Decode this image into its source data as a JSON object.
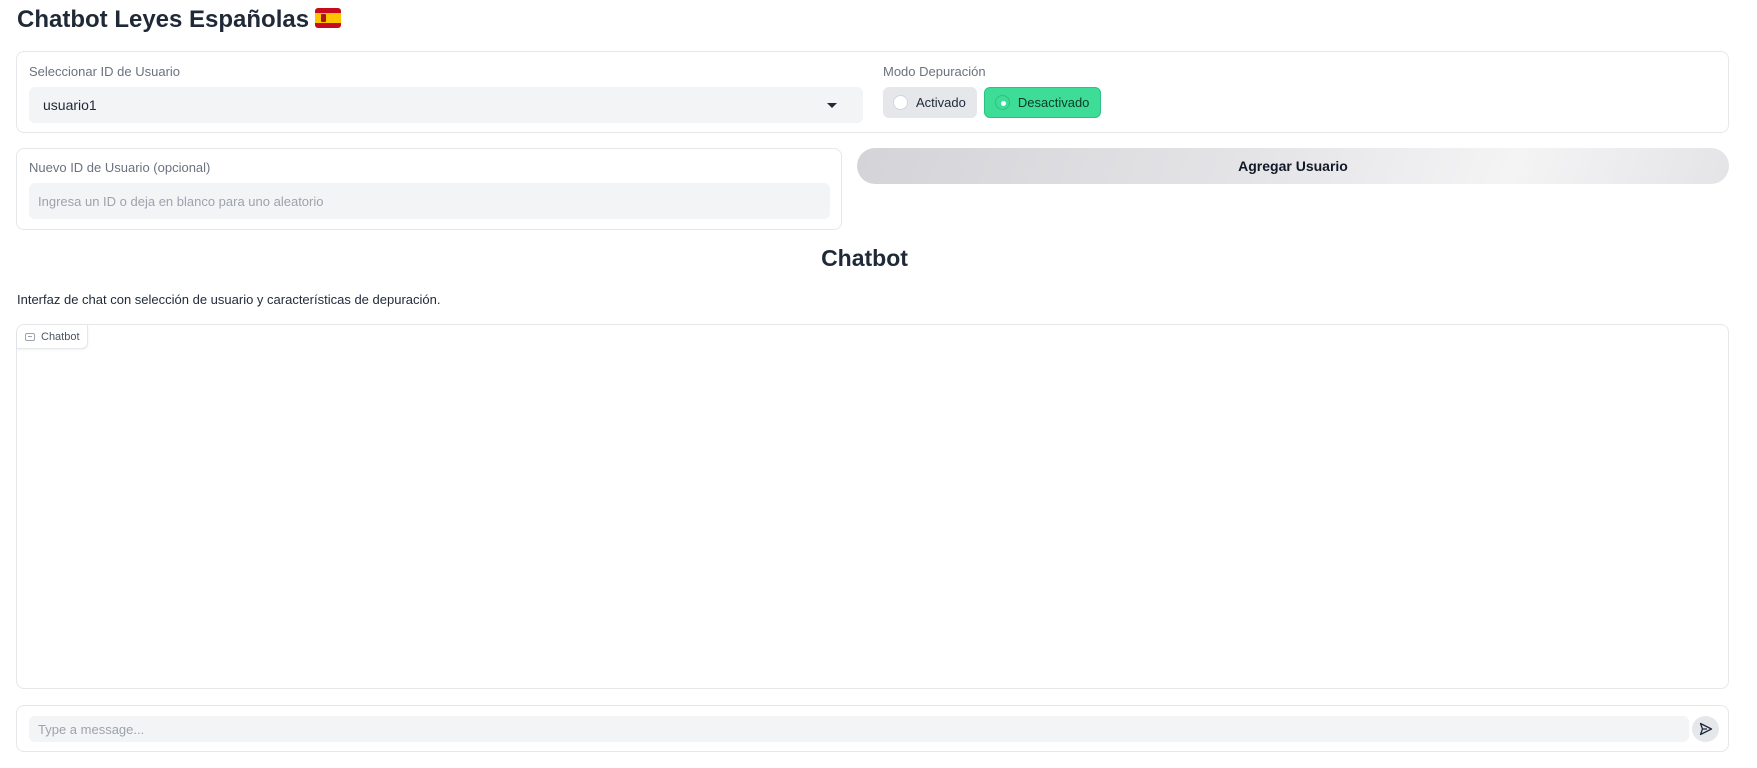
{
  "app": {
    "title": "Chatbot Leyes Españolas",
    "title_flag_icon": "spain-flag-icon"
  },
  "user_select": {
    "label": "Seleccionar ID de Usuario",
    "selected_value": "usuario1"
  },
  "debug_mode": {
    "label": "Modo Depuración",
    "options": [
      {
        "label": "Activado",
        "selected": false
      },
      {
        "label": "Desactivado",
        "selected": true
      }
    ],
    "accent_color": "#3ddc97"
  },
  "new_user": {
    "label": "Nuevo ID de Usuario (opcional)",
    "value": "",
    "placeholder": "Ingresa un ID o deja en blanco para uno aleatorio"
  },
  "add_user_button": {
    "label": "Agregar Usuario"
  },
  "chat_section": {
    "heading": "Chatbot",
    "description": "Interfaz de chat con selección de usuario y características de depuración.",
    "tag_label": "Chatbot",
    "tag_icon": "chat-bubble-icon",
    "messages": []
  },
  "message_bar": {
    "placeholder": "Type a message...",
    "value": "",
    "send_icon": "send-icon"
  }
}
